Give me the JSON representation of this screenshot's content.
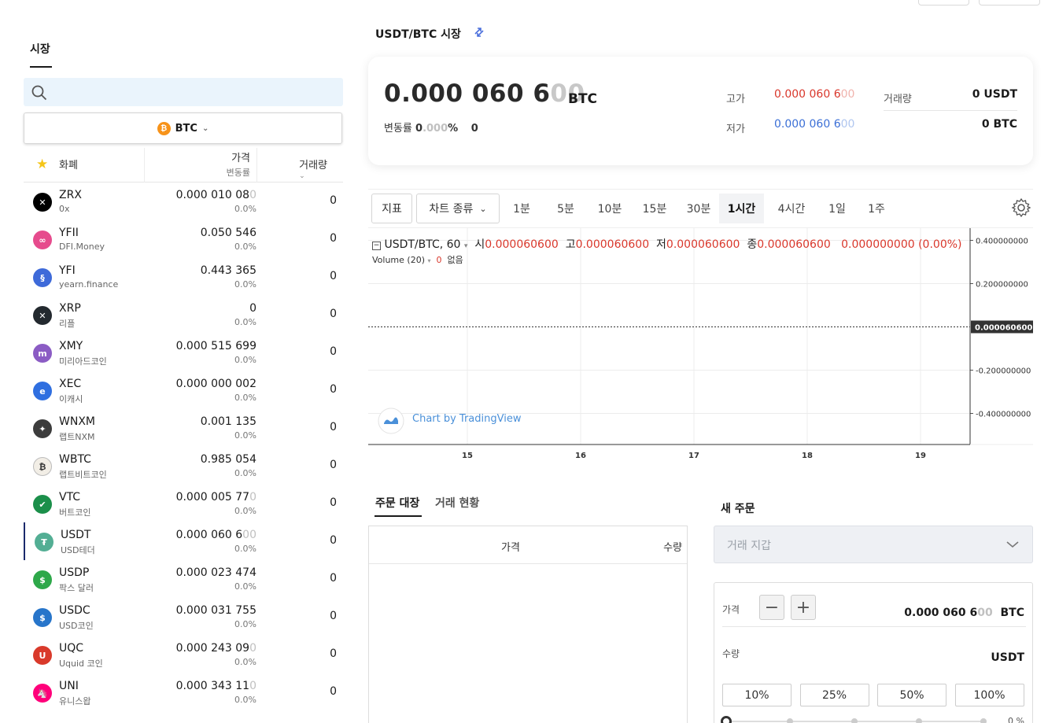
{
  "left": {
    "market_tab": "시장",
    "base_currency": "BTC",
    "header": {
      "coin": "화폐",
      "price": "가격",
      "change": "변동률",
      "volume": "거래량"
    },
    "rows": [
      {
        "symbol": "ZRX",
        "name": "0x",
        "price": "0.000 010 08",
        "price_fade": "0",
        "change": "0.0%",
        "volume": "0",
        "icon_color": "#000000",
        "icon": "zrx-icon",
        "glyph": "✕"
      },
      {
        "symbol": "YFII",
        "name": "DFI.Money",
        "price": "0.050 546",
        "price_fade": "",
        "change": "0.0%",
        "volume": "0",
        "icon_color": "#e64b8d",
        "icon": "yfii-icon",
        "glyph": "∞"
      },
      {
        "symbol": "YFI",
        "name": "yearn.finance",
        "price": "0.443 365",
        "price_fade": "",
        "change": "0.0%",
        "volume": "0",
        "icon_color": "#3e6ad9",
        "icon": "yfi-icon",
        "glyph": "§"
      },
      {
        "symbol": "XRP",
        "name": "리플",
        "price": "0",
        "price_fade": "",
        "change": "0.0%",
        "volume": "0",
        "icon_color": "#23292f",
        "icon": "xrp-icon",
        "glyph": "✕"
      },
      {
        "symbol": "XMY",
        "name": "미리아드코인",
        "price": "0.000 515 699",
        "price_fade": "",
        "change": "0.0%",
        "volume": "0",
        "icon_color": "#8b5cc4",
        "icon": "xmy-icon",
        "glyph": "m"
      },
      {
        "symbol": "XEC",
        "name": "이캐시",
        "price": "0.000 000 002",
        "price_fade": "",
        "change": "0.0%",
        "volume": "0",
        "icon_color": "#2f6fe0",
        "icon": "xec-icon",
        "glyph": "e"
      },
      {
        "symbol": "WNXM",
        "name": "랩트NXM",
        "price": "0.001 135",
        "price_fade": "",
        "change": "0.0%",
        "volume": "0",
        "icon_color": "#3c3c3c",
        "icon": "wnxm-icon",
        "glyph": "✦"
      },
      {
        "symbol": "WBTC",
        "name": "랩트비트코인",
        "price": "0.985 054",
        "price_fade": "",
        "change": "0.0%",
        "volume": "0",
        "icon_color": "#f2eee6",
        "icon": "wbtc-icon",
        "glyph": "₿"
      },
      {
        "symbol": "VTC",
        "name": "버트코인",
        "price": "0.000 005 77",
        "price_fade": "0",
        "change": "0.0%",
        "volume": "0",
        "icon_color": "#1b8f4a",
        "icon": "vtc-icon",
        "glyph": "✔"
      },
      {
        "symbol": "USDT",
        "name": "USD테더",
        "price": "0.000 060 6",
        "price_fade": "00",
        "change": "0.0%",
        "volume": "0",
        "icon_color": "#53ae94",
        "icon": "usdt-icon",
        "glyph": "₮",
        "selected": true
      },
      {
        "symbol": "USDP",
        "name": "팍스 달러",
        "price": "0.000 023 474",
        "price_fade": "",
        "change": "0.0%",
        "volume": "0",
        "icon_color": "#2ea84a",
        "icon": "usdp-icon",
        "glyph": "$"
      },
      {
        "symbol": "USDC",
        "name": "USD코인",
        "price": "0.000 031 755",
        "price_fade": "",
        "change": "0.0%",
        "volume": "0",
        "icon_color": "#2775ca",
        "icon": "usdc-icon",
        "glyph": "$"
      },
      {
        "symbol": "UQC",
        "name": "Uquid 코인",
        "price": "0.000 243 09",
        "price_fade": "0",
        "change": "0.0%",
        "volume": "0",
        "icon_color": "#d93a2b",
        "icon": "uqc-icon",
        "glyph": "U"
      },
      {
        "symbol": "UNI",
        "name": "유니스왑",
        "price": "0.000 343 11",
        "price_fade": "0",
        "change": "0.0%",
        "volume": "0",
        "icon_color": "#ff007a",
        "icon": "uni-icon",
        "glyph": "🦄"
      }
    ]
  },
  "ticker": {
    "pair_title": "USDT/BTC 시장",
    "price_main": "0.000 060 6",
    "price_fade": "00",
    "unit": "BTC",
    "change_label": "변동률",
    "change_main": "0",
    "change_fade": ".000",
    "change_pct": "%",
    "change_abs": "0",
    "high_label": "고가",
    "high_main": "0.000 060 6",
    "high_fade": "00",
    "low_label": "저가",
    "low_main": "0.000 060 6",
    "low_fade": "00",
    "volume_label": "거래량",
    "volume_usdt": "0 USDT",
    "volume_btc": "0 BTC",
    "high_color": "#d9372b",
    "low_color": "#3b6fd6"
  },
  "chart_toolbar": {
    "indicator": "지표",
    "chart_type": "차트 종류",
    "intervals": [
      "1분",
      "5분",
      "10분",
      "15분",
      "30분",
      "1시간",
      "4시간",
      "1일",
      "1주"
    ],
    "active_interval": "1시간"
  },
  "chart_legend": {
    "symbol": "USDT/BTC, 60",
    "open_label": "시",
    "open": "0.000060600",
    "high_label": "고",
    "high": "0.000060600",
    "low_label": "저",
    "low": "0.000060600",
    "close_label": "종",
    "close": "0.000060600",
    "change": "0.000000000 (0.00%)",
    "volume_label": "Volume (20)",
    "volume_value": "0",
    "volume_none": "없음",
    "watermark": "Chart by TradingView"
  },
  "chart_data": {
    "type": "line",
    "x_ticks": [
      "15",
      "16",
      "17",
      "18",
      "19"
    ],
    "y_ticks": [
      "0.400000000",
      "0.200000000",
      "-0.200000000",
      "-0.400000000"
    ],
    "y_tick_values": [
      0.4,
      0.2,
      -0.2,
      -0.4
    ],
    "ylim": [
      -0.5,
      0.5
    ],
    "last_value_label": "0.000060600",
    "series": [
      {
        "values": [
          6.06e-05,
          6.06e-05,
          6.06e-05,
          6.06e-05,
          6.06e-05
        ]
      }
    ]
  },
  "orderbook": {
    "tab_book": "주문 대장",
    "tab_trades": "거래 현황",
    "col_price": "가격",
    "col_qty": "수량"
  },
  "new_order": {
    "title": "새 주문",
    "wallet_placeholder": "거래 지갑",
    "price_label": "가격",
    "price_main": "0.000 060 6",
    "price_fade": "00",
    "price_unit": "BTC",
    "qty_label": "수량",
    "qty_unit": "USDT",
    "percents": [
      "10%",
      "25%",
      "50%",
      "100%"
    ],
    "slider_pct": "0 %"
  }
}
